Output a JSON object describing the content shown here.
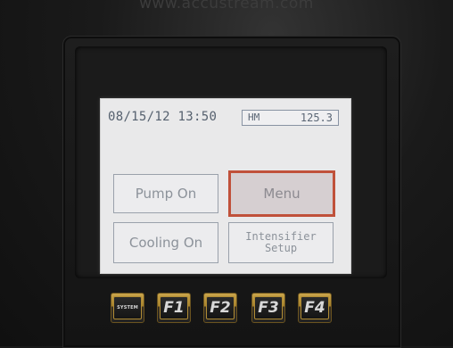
{
  "watermark": "www.accustream.com",
  "status": {
    "datetime": "08/15/12 13:50",
    "readout_label": "HM",
    "readout_value": "125.3"
  },
  "buttons": {
    "pump_on": "Pump On",
    "menu": "Menu",
    "cooling_on": "Cooling On",
    "intensifier_line1": "Intensifier",
    "intensifier_line2": "Setup"
  },
  "fkeys": [
    "SYSTEM",
    "F1",
    "F2",
    "F3",
    "F4"
  ],
  "colors": {
    "screen_bg": "#e9e9ea",
    "menu_highlight": "#c0513a",
    "fkey_gold": "#c9a44a"
  }
}
